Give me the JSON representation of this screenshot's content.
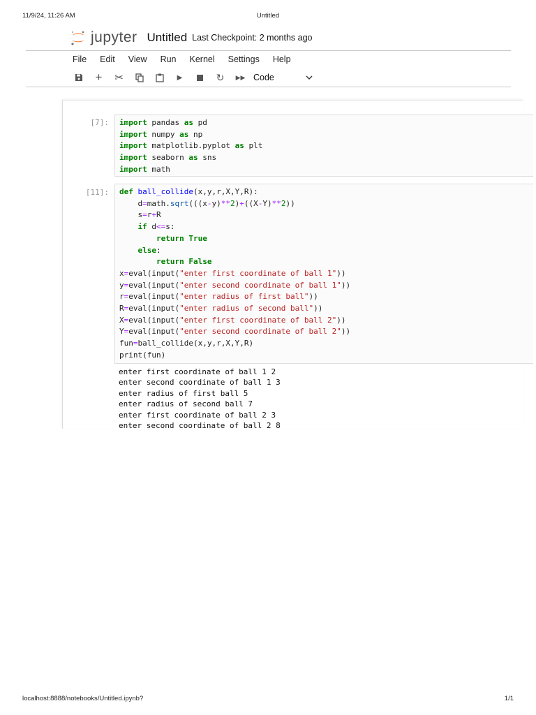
{
  "print_header": {
    "datetime": "11/9/24, 11:26 AM",
    "title": "Untitled"
  },
  "print_footer": {
    "url": "localhost:8888/notebooks/Untitled.ipynb?",
    "page": "1/1"
  },
  "app": {
    "logo_text": "jupyter",
    "notebook_title": "Untitled",
    "checkpoint": "Last Checkpoint: 2 months ago",
    "accent": "#f37726"
  },
  "menu": [
    "File",
    "Edit",
    "View",
    "Run",
    "Kernel",
    "Settings",
    "Help"
  ],
  "toolbar": {
    "cell_type": "Code"
  },
  "cells": [
    {
      "prompt": "[7]:",
      "lines": [
        [
          [
            "import",
            "k"
          ],
          [
            " pandas ",
            ""
          ],
          [
            "as",
            "k"
          ],
          [
            " pd",
            ""
          ]
        ],
        [
          [
            "import",
            "k"
          ],
          [
            " numpy ",
            ""
          ],
          [
            "as",
            "k"
          ],
          [
            " np",
            ""
          ]
        ],
        [
          [
            "import",
            "k"
          ],
          [
            " matplotlib.pyplot ",
            ""
          ],
          [
            "as",
            "k"
          ],
          [
            " plt",
            ""
          ]
        ],
        [
          [
            "import",
            "k"
          ],
          [
            " seaborn ",
            ""
          ],
          [
            "as",
            "k"
          ],
          [
            " sns",
            ""
          ]
        ],
        [
          [
            "import",
            "k"
          ],
          [
            " math",
            ""
          ]
        ]
      ]
    },
    {
      "prompt": "[11]:",
      "lines": [
        [
          [
            "def",
            "k"
          ],
          [
            " ",
            ""
          ],
          [
            "ball_collide",
            "d"
          ],
          [
            "(x,y,r,X,Y,R):",
            ""
          ]
        ],
        [
          [
            "    d",
            ""
          ],
          [
            "=",
            "o"
          ],
          [
            "math.",
            ""
          ],
          [
            "sqrt",
            "f"
          ],
          [
            "(((x",
            ""
          ],
          [
            "-",
            "o"
          ],
          [
            "y)",
            ""
          ],
          [
            "**",
            "o"
          ],
          [
            "2",
            "n"
          ],
          [
            ")",
            ""
          ],
          [
            "+",
            "o"
          ],
          [
            "((X",
            ""
          ],
          [
            "-",
            "o"
          ],
          [
            "Y)",
            ""
          ],
          [
            "**",
            "o"
          ],
          [
            "2",
            "n"
          ],
          [
            "))",
            ""
          ]
        ],
        [
          [
            "    s",
            ""
          ],
          [
            "=",
            "o"
          ],
          [
            "r",
            ""
          ],
          [
            "+",
            "o"
          ],
          [
            "R",
            ""
          ]
        ],
        [
          [
            "    ",
            ""
          ],
          [
            "if",
            "k"
          ],
          [
            " d",
            ""
          ],
          [
            "<=",
            "o"
          ],
          [
            "s:",
            ""
          ]
        ],
        [
          [
            "        ",
            ""
          ],
          [
            "return",
            "k"
          ],
          [
            " ",
            ""
          ],
          [
            "True",
            "k"
          ]
        ],
        [
          [
            "    ",
            ""
          ],
          [
            "else",
            "k"
          ],
          [
            ":",
            ""
          ]
        ],
        [
          [
            "        ",
            ""
          ],
          [
            "return",
            "k"
          ],
          [
            " ",
            ""
          ],
          [
            "False",
            "k"
          ]
        ],
        [
          [
            "x",
            ""
          ],
          [
            "=",
            "o"
          ],
          [
            "eval(input(",
            ""
          ],
          [
            "\"enter first coordinate of ball 1\"",
            "s"
          ],
          [
            "))",
            ""
          ]
        ],
        [
          [
            "y",
            ""
          ],
          [
            "=",
            "o"
          ],
          [
            "eval(input(",
            ""
          ],
          [
            "\"enter second coordinate of ball 1\"",
            "s"
          ],
          [
            "))",
            ""
          ]
        ],
        [
          [
            "r",
            ""
          ],
          [
            "=",
            "o"
          ],
          [
            "eval(input(",
            ""
          ],
          [
            "\"enter radius of first ball\"",
            "s"
          ],
          [
            "))",
            ""
          ]
        ],
        [
          [
            "R",
            ""
          ],
          [
            "=",
            "o"
          ],
          [
            "eval(input(",
            ""
          ],
          [
            "\"enter radius of second ball\"",
            "s"
          ],
          [
            "))",
            ""
          ]
        ],
        [
          [
            "X",
            ""
          ],
          [
            "=",
            "o"
          ],
          [
            "eval(input(",
            ""
          ],
          [
            "\"enter first coordinate of ball 2\"",
            "s"
          ],
          [
            "))",
            ""
          ]
        ],
        [
          [
            "Y",
            ""
          ],
          [
            "=",
            "o"
          ],
          [
            "eval(input(",
            ""
          ],
          [
            "\"enter second coordinate of ball 2\"",
            "s"
          ],
          [
            "))",
            ""
          ]
        ],
        [
          [
            "fun",
            ""
          ],
          [
            "=",
            "o"
          ],
          [
            "ball_collide(x,y,r,X,Y,R)",
            ""
          ]
        ],
        [
          [
            "print(fun)",
            ""
          ]
        ]
      ],
      "output": [
        "enter first coordinate of ball 1 2",
        "enter second coordinate of ball 1 3",
        "enter radius of first ball 5",
        "enter radius of second ball 7",
        "enter first coordinate of ball 2 3",
        "enter second coordinate of ball 2 8"
      ]
    }
  ]
}
